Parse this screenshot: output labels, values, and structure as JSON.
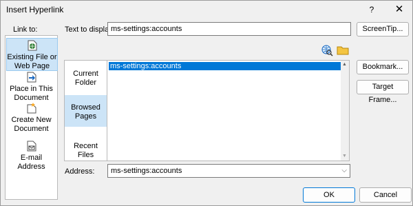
{
  "window": {
    "title": "Insert Hyperlink",
    "help_label": "?",
    "close_label": "✕"
  },
  "link_to": {
    "label": "Link to:",
    "items": [
      {
        "line1": "Existing File or",
        "line2": "Web Page",
        "icon": "web-page-icon",
        "selected": true
      },
      {
        "line1": "Place in This",
        "line2": "Document",
        "icon": "place-in-document-icon",
        "selected": false
      },
      {
        "line1": "Create New",
        "line2": "Document",
        "icon": "new-document-icon",
        "selected": false
      },
      {
        "line1": "E-mail Address",
        "line2": "",
        "icon": "email-icon",
        "selected": false
      }
    ]
  },
  "text_to_display": {
    "label": "Text to display:",
    "value": "ms-settings:accounts"
  },
  "buttons": {
    "screentip": "ScreenTip...",
    "bookmark": "Bookmark...",
    "target_frame": "Target Frame...",
    "ok": "OK",
    "cancel": "Cancel"
  },
  "look_in": {
    "items": [
      {
        "line1": "Current",
        "line2": "Folder",
        "selected": false
      },
      {
        "line1": "Browsed",
        "line2": "Pages",
        "selected": true
      },
      {
        "line1": "Recent Files",
        "line2": "",
        "selected": false
      }
    ]
  },
  "file_list": {
    "rows": [
      "ms-settings:accounts"
    ]
  },
  "address": {
    "label": "Address:",
    "value": "ms-settings:accounts"
  },
  "colors": {
    "selection": "#0078d7",
    "selected_panel": "#cce4f7",
    "dialog_bg": "#f0f0f0"
  }
}
